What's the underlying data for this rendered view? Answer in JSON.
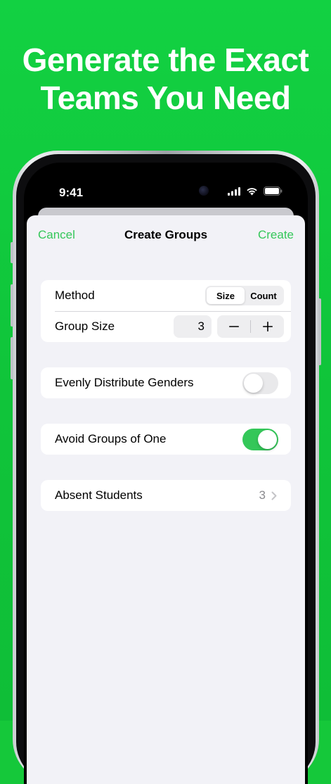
{
  "headline": {
    "line1": "Generate the Exact",
    "line2": "Teams You Need"
  },
  "status_bar": {
    "time": "9:41",
    "icons": [
      "cellular-signal-icon",
      "wifi-icon",
      "battery-icon"
    ]
  },
  "nav": {
    "cancel_label": "Cancel",
    "title": "Create Groups",
    "create_label": "Create"
  },
  "method": {
    "label": "Method",
    "options": [
      "Size",
      "Count"
    ],
    "selected": "Size"
  },
  "group_size": {
    "label": "Group Size",
    "value": "3"
  },
  "distribute_genders": {
    "label": "Evenly Distribute Genders",
    "enabled": false
  },
  "avoid_groups_of_one": {
    "label": "Avoid Groups of One",
    "enabled": true
  },
  "absent_students": {
    "label": "Absent Students",
    "count": "3"
  },
  "colors": {
    "background": "#12d142",
    "accent": "#34c759",
    "sheet": "#f2f2f7"
  }
}
